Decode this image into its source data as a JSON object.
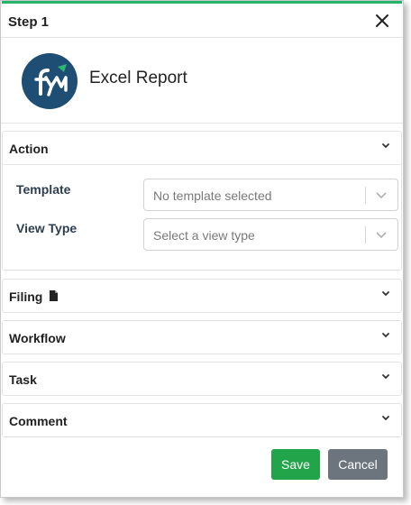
{
  "dialog": {
    "title": "Step 1",
    "app_name": "Excel Report",
    "accent_color": "#27b36a",
    "brand_color": "#1e4e74"
  },
  "sections": {
    "action": {
      "title": "Action"
    },
    "filing": {
      "title": "Filing",
      "icon": "document-icon"
    },
    "workflow": {
      "title": "Workflow"
    },
    "task": {
      "title": "Task"
    },
    "comment": {
      "title": "Comment"
    }
  },
  "fields": {
    "template": {
      "label": "Template",
      "placeholder": "No template selected"
    },
    "view_type": {
      "label": "View Type",
      "placeholder": "Select a view type"
    }
  },
  "buttons": {
    "save": "Save",
    "cancel": "Cancel"
  }
}
